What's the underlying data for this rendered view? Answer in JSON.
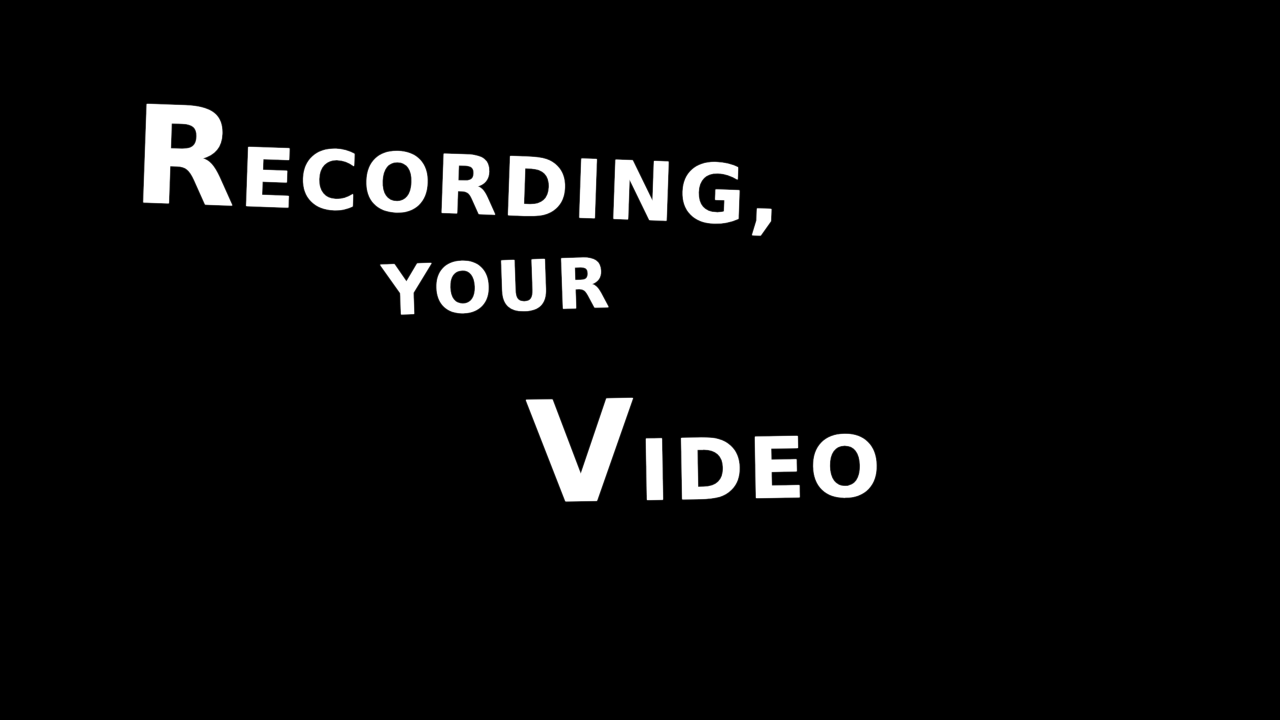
{
  "background_color": "#000000",
  "text_color": "#ffffff",
  "lines": [
    {
      "first": "R",
      "rest": "ECORDING,"
    },
    {
      "text": "YOUR"
    },
    {
      "first": "V",
      "rest": "IDEO"
    }
  ]
}
